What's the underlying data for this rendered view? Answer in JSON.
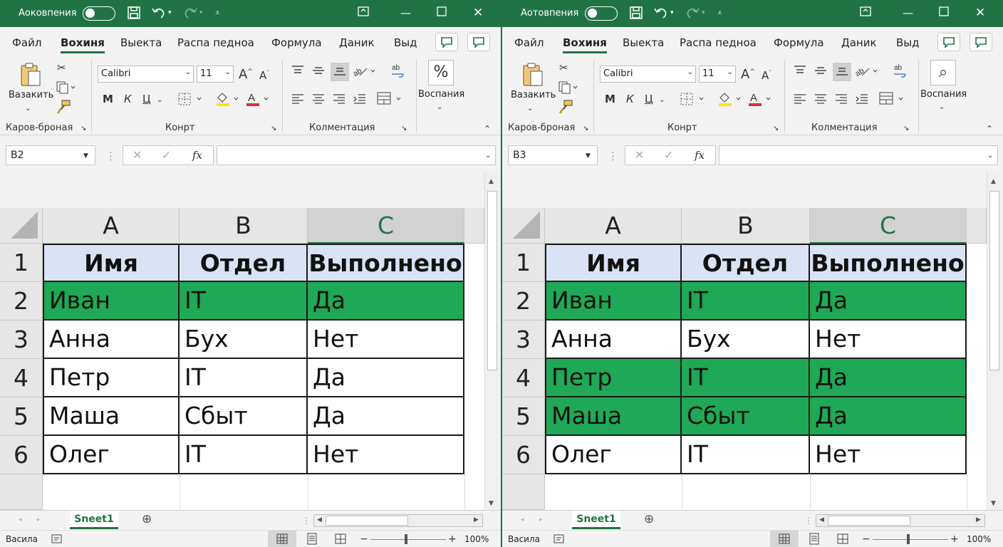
{
  "colors": {
    "brand": "#217346",
    "highlight": "#1fa855",
    "header_fill": "#dae3f3"
  },
  "windows": [
    {
      "autosave_label": "Аоковпения",
      "menu": [
        "Файл",
        "Вохиня",
        "Выекта",
        "Распа педноа",
        "Формула",
        "Даник",
        "Выд"
      ],
      "ribbon": {
        "paste_label": "Вазакить",
        "font_name": "Calibri",
        "font_size": "11",
        "bold": "М",
        "italic": "К",
        "underline": "Ц",
        "g1": "Каров-броная",
        "g2": "Конрт",
        "g3": "Колментация",
        "number_label": "Воспания",
        "number_icon": "%",
        "number_icon_name": "percent-icon"
      },
      "name_box": "B2",
      "col_headers": [
        "A",
        "B",
        "C"
      ],
      "row_numbers": [
        "1",
        "2",
        "3",
        "4",
        "5",
        "6"
      ],
      "table_headers": [
        "Имя",
        "Отдел",
        "Выполнено"
      ],
      "rows": [
        [
          "Иван",
          "IT",
          "Да"
        ],
        [
          "Анна",
          "Бух",
          "Нет"
        ],
        [
          "Петр",
          "IT",
          "Да"
        ],
        [
          "Маша",
          "Сбыт",
          "Да"
        ],
        [
          "Олег",
          "IT",
          "Нет"
        ]
      ],
      "highlighted_rows": [
        0
      ],
      "sheet_name": "Sneet1",
      "status_left": "Васила",
      "zoom": "100%"
    },
    {
      "autosave_label": "Аотовпения",
      "menu": [
        "Файл",
        "Вохиня",
        "Выекта",
        "Распа педноа",
        "Формула",
        "Даник",
        "Выд"
      ],
      "ribbon": {
        "paste_label": "Вазакить",
        "font_name": "Calibri",
        "font_size": "11",
        "bold": "М",
        "italic": "К",
        "underline": "Ц",
        "g1": "Каров-броная",
        "g2": "Конрт",
        "g3": "Колментация",
        "number_label": "Воспания",
        "number_icon": "⌕",
        "number_icon_name": "search-icon"
      },
      "name_box": "B3",
      "col_headers": [
        "A",
        "B",
        "C"
      ],
      "row_numbers": [
        "1",
        "2",
        "3",
        "4",
        "5",
        "6"
      ],
      "table_headers": [
        "Имя",
        "Отдел",
        "Выполнено"
      ],
      "rows": [
        [
          "Иван",
          "IT",
          "Да"
        ],
        [
          "Анна",
          "Бух",
          "Нет"
        ],
        [
          "Петр",
          "IT",
          "Да"
        ],
        [
          "Маша",
          "Сбыт",
          "Да"
        ],
        [
          "Олег",
          "IT",
          "Нет"
        ]
      ],
      "highlighted_rows": [
        0,
        2,
        3
      ],
      "sheet_name": "Sneet1",
      "status_left": "Васила",
      "zoom": "100%"
    }
  ]
}
